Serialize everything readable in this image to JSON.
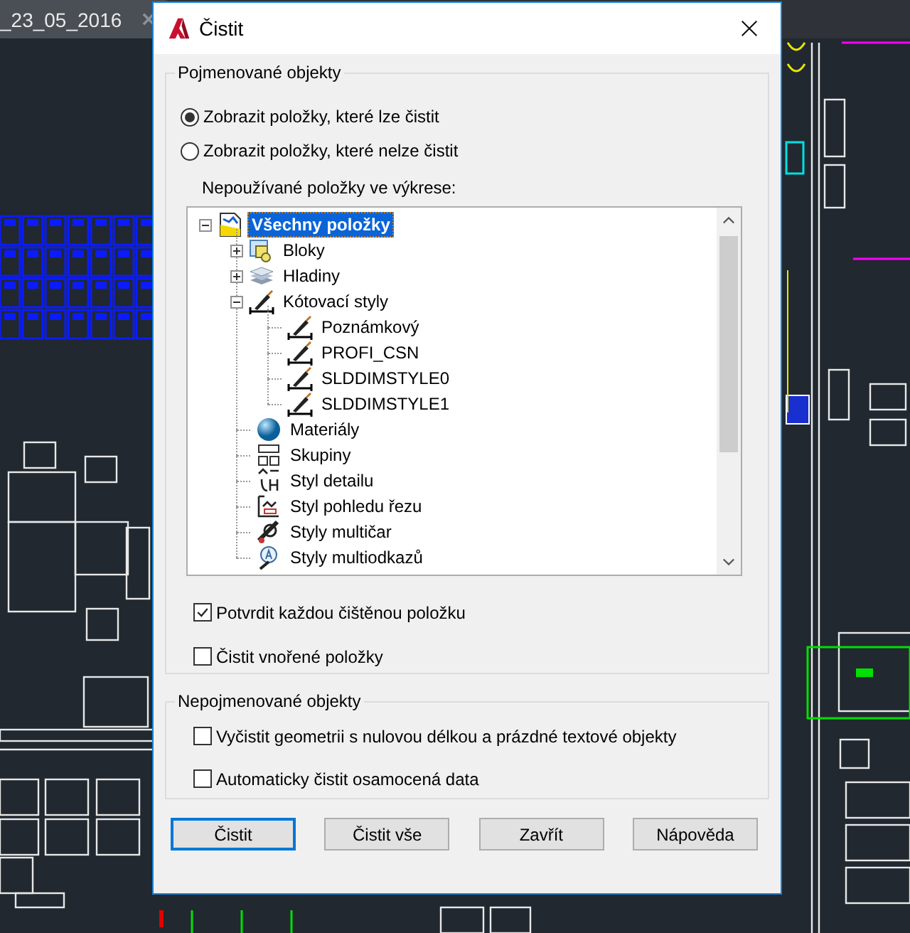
{
  "document_tab": {
    "title": "_23_05_2016"
  },
  "dialog": {
    "title": "Čistit",
    "named_group": {
      "title": "Pojmenované objekty",
      "options": [
        {
          "label": "Zobrazit položky, které lze čistit",
          "selected": true
        },
        {
          "label": "Zobrazit položky, které nelze čistit",
          "selected": false
        }
      ],
      "tree_label": "Nepoužívané položky ve výkrese:",
      "tree": {
        "label": "Všechny položky",
        "kind": "root",
        "expanded": true,
        "selected": true,
        "children": [
          {
            "label": "Bloky",
            "kind": "blocks",
            "expanded": false,
            "selected": false
          },
          {
            "label": "Hladiny",
            "kind": "layers",
            "expanded": false,
            "selected": false
          },
          {
            "label": "Kótovací styly",
            "kind": "dimstyle",
            "expanded": true,
            "selected": false,
            "children": [
              {
                "label": "Poznámkový",
                "kind": "dimstyle",
                "selected": false
              },
              {
                "label": "PROFI_CSN",
                "kind": "dimstyle",
                "selected": false
              },
              {
                "label": "SLDDIMSTYLE0",
                "kind": "dimstyle",
                "selected": false
              },
              {
                "label": "SLDDIMSTYLE1",
                "kind": "dimstyle",
                "selected": false
              }
            ]
          },
          {
            "label": "Materiály",
            "kind": "material",
            "selected": false
          },
          {
            "label": "Skupiny",
            "kind": "group",
            "selected": false
          },
          {
            "label": "Styl detailu",
            "kind": "detail",
            "selected": false
          },
          {
            "label": "Styl pohledu řezu",
            "kind": "section",
            "selected": false
          },
          {
            "label": "Styly multičar",
            "kind": "mline",
            "selected": false
          },
          {
            "label": "Styly multiodkazů",
            "kind": "mleader",
            "selected": false
          }
        ]
      },
      "checkboxes": [
        {
          "label": "Potvrdit každou čištěnou položku",
          "checked": true
        },
        {
          "label": "Čistit vnořené položky",
          "checked": false
        }
      ]
    },
    "unnamed_group": {
      "title": "Nepojmenované objekty",
      "checkboxes": [
        {
          "label": "Vyčistit geometrii s nulovou délkou a prázdné textové objekty",
          "checked": false
        },
        {
          "label": "Automaticky čistit osamocená data",
          "checked": false
        }
      ]
    },
    "buttons": [
      {
        "label": "Čistit",
        "default": true
      },
      {
        "label": "Čistit vše",
        "default": false
      },
      {
        "label": "Zavřít",
        "default": false
      },
      {
        "label": "Nápověda",
        "default": false
      }
    ]
  }
}
